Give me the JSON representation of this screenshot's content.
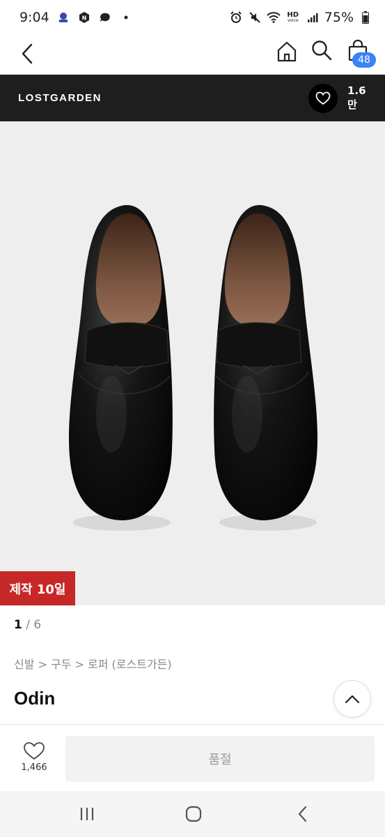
{
  "status_bar": {
    "time": "9:04",
    "battery": "75%",
    "hd_label": "HD",
    "voice_label": "voice"
  },
  "nav": {
    "cart_count": "48"
  },
  "brand": {
    "name": "LOSTGARDEN",
    "like_count": "1.6만"
  },
  "product": {
    "badge": "제작 10일",
    "image_index": "1",
    "image_total": "6",
    "pager_sep": "/",
    "breadcrumb": "신발 > 구두 > 로퍼 (로스트가든)",
    "name": "Odin"
  },
  "actions": {
    "like_count": "1,466",
    "buy_label": "품절"
  },
  "colors": {
    "brand_bar": "#1e1e1e",
    "badge": "#c62828",
    "cart_badge": "#3b82f6"
  }
}
